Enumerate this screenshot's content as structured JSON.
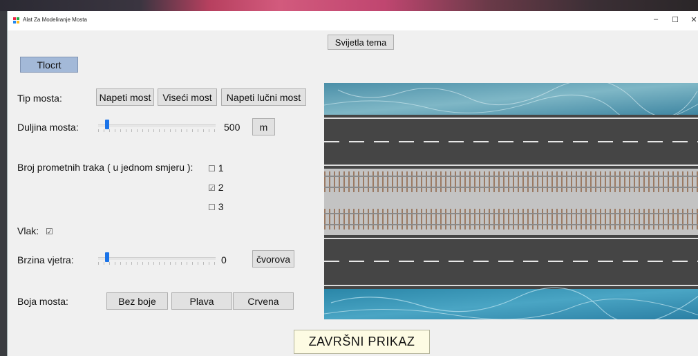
{
  "window": {
    "title": "Alat Za Modeliranje Mosta",
    "controls": {
      "minimize": "–",
      "maximize": "☐",
      "close": "✕"
    }
  },
  "header": {
    "theme_button": "Svijetla tema",
    "view_button": "Tlocrt"
  },
  "bridge_type": {
    "label": "Tip mosta:",
    "options": [
      "Napeti most",
      "Viseći most",
      "Napeti lučni most"
    ]
  },
  "length": {
    "label": "Duljina mosta:",
    "value": "500",
    "unit_button": "m",
    "slider_fraction": 0.0
  },
  "lanes": {
    "label": "Broj prometnih traka ( u jednom smjeru ):",
    "options": [
      {
        "label": "1",
        "checked": false
      },
      {
        "label": "2",
        "checked": true
      },
      {
        "label": "3",
        "checked": false
      }
    ]
  },
  "train": {
    "label": "Vlak:",
    "checked": true
  },
  "wind": {
    "label": "Brzina vjetra:",
    "value": "0",
    "unit_button": "čvorova",
    "slider_fraction": 0.0
  },
  "color": {
    "label": "Boja mosta:",
    "options": [
      "Bez boje",
      "Plava",
      "Crvena"
    ]
  },
  "final_button": "ZAVRŠNI  PRIKAZ",
  "icons": {
    "checked": "☑",
    "unchecked": "☐"
  }
}
